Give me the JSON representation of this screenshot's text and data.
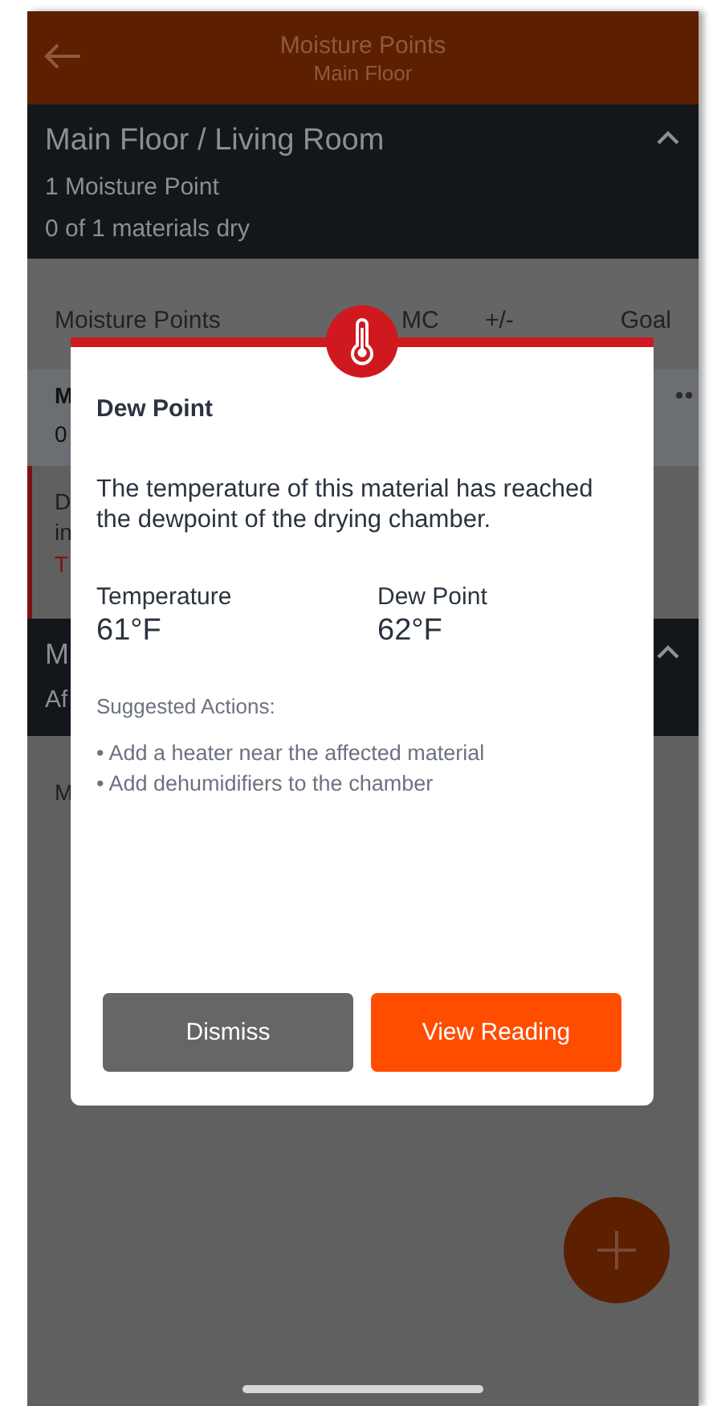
{
  "header": {
    "title": "Moisture Points",
    "subtitle": "Main Floor"
  },
  "sections": [
    {
      "title": "Main Floor / Living Room",
      "lines": [
        "1 Moisture Point",
        "0 of 1 materials dry"
      ],
      "expanded": true
    },
    {
      "title": "M",
      "lines": [
        "Af"
      ],
      "expanded": true
    }
  ],
  "columns": [
    "Moisture Points",
    "MC",
    "+/-",
    "Goal"
  ],
  "point_row": {
    "name": "M",
    "value": "0"
  },
  "alert_row": {
    "lines": [
      "D",
      "in"
    ],
    "link": "T"
  },
  "next_row": {
    "name": "M"
  },
  "dialog": {
    "title": "Dew Point",
    "message": "The temperature of this material has reached the dewpoint of the drying chamber.",
    "stats": [
      {
        "label": "Temperature",
        "value": "61°F"
      },
      {
        "label": "Dew Point",
        "value": "62°F"
      }
    ],
    "actions_label": "Suggested Actions:",
    "actions": [
      "• Add a heater near the affected material",
      "• Add dehumidifiers to the chamber"
    ],
    "buttons": [
      {
        "label": "Dismiss",
        "kind": "secondary"
      },
      {
        "label": "View Reading",
        "kind": "primary"
      }
    ]
  }
}
